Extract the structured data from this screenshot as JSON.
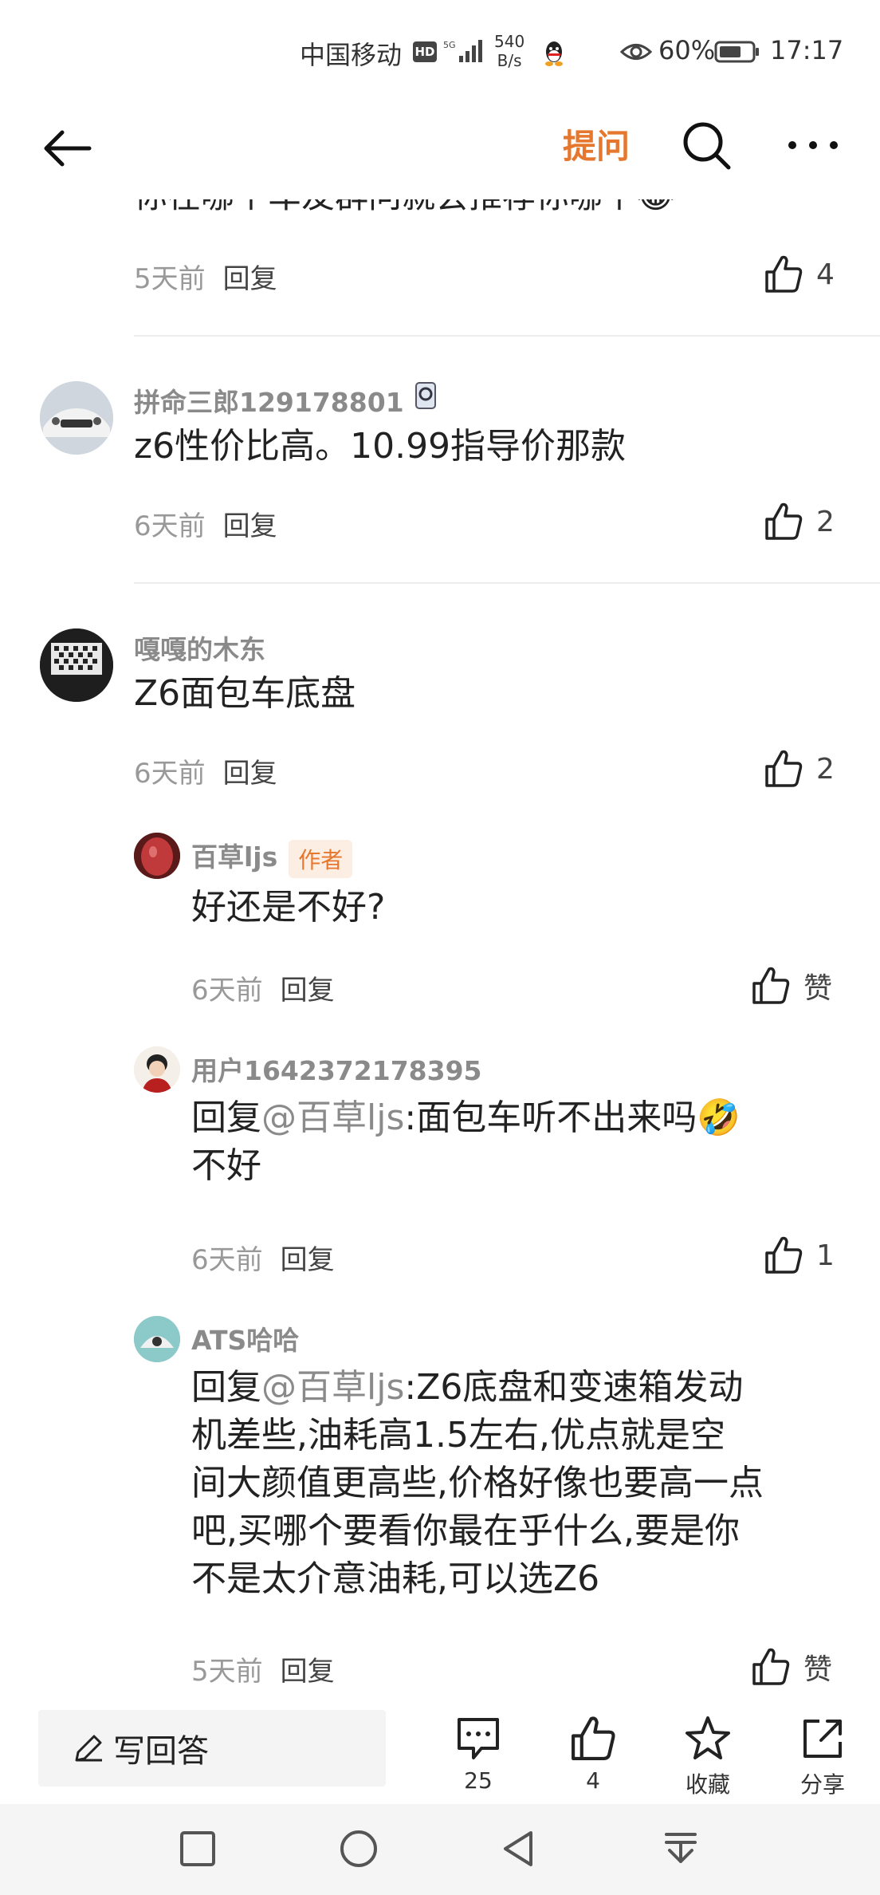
{
  "status_bar": {
    "carrier": "中国移动",
    "hd": "HD",
    "network": "5G",
    "speed_value": "540",
    "speed_unit": "B/s",
    "battery": "60%",
    "time": "17:17"
  },
  "header": {
    "ask_label": "提问"
  },
  "clipped_comment": {
    "text": "你在哪个车友群问就会推荐你哪个😂",
    "time": "5天前",
    "reply": "回复",
    "likes": "4"
  },
  "comments": [
    {
      "username": "拼命三郎129178801",
      "text": "z6性价比高。10.99指导价那款",
      "time": "6天前",
      "reply": "回复",
      "likes": "2"
    },
    {
      "username": "嘎嘎的木东",
      "text": "Z6面包车底盘",
      "time": "6天前",
      "reply": "回复",
      "likes": "2",
      "replies": [
        {
          "username": "百草ljs",
          "badge": "作者",
          "text": "好还是不好?",
          "time": "6天前",
          "reply": "回复",
          "likes": "赞"
        },
        {
          "username": "用户1642372178395",
          "prefix": "回复",
          "mention": "@百草ljs",
          "text": ":面包车听不出来吗🤣",
          "text2": "不好",
          "time": "6天前",
          "reply": "回复",
          "likes": "1"
        },
        {
          "username": "ATS哈哈",
          "prefix": "回复",
          "mention": "@百草ljs",
          "line1": ":Z6底盘和变速箱发动",
          "line2": "机差些,油耗高1.5左右,优点就是空",
          "line3": "间大颜值更高些,价格好像也要高一点",
          "line4": "吧,买哪个要看你最在乎什么,要是你",
          "line5": "不是太介意油耗,可以选Z6",
          "time": "5天前",
          "reply": "回复",
          "likes": "赞"
        }
      ]
    }
  ],
  "action_bar": {
    "write_label": "写回答",
    "comments_count": "25",
    "likes_count": "4",
    "favorite_label": "收藏",
    "share_label": "分享"
  },
  "colors": {
    "accent": "#e5772e",
    "muted": "#999999",
    "text": "#222222"
  }
}
